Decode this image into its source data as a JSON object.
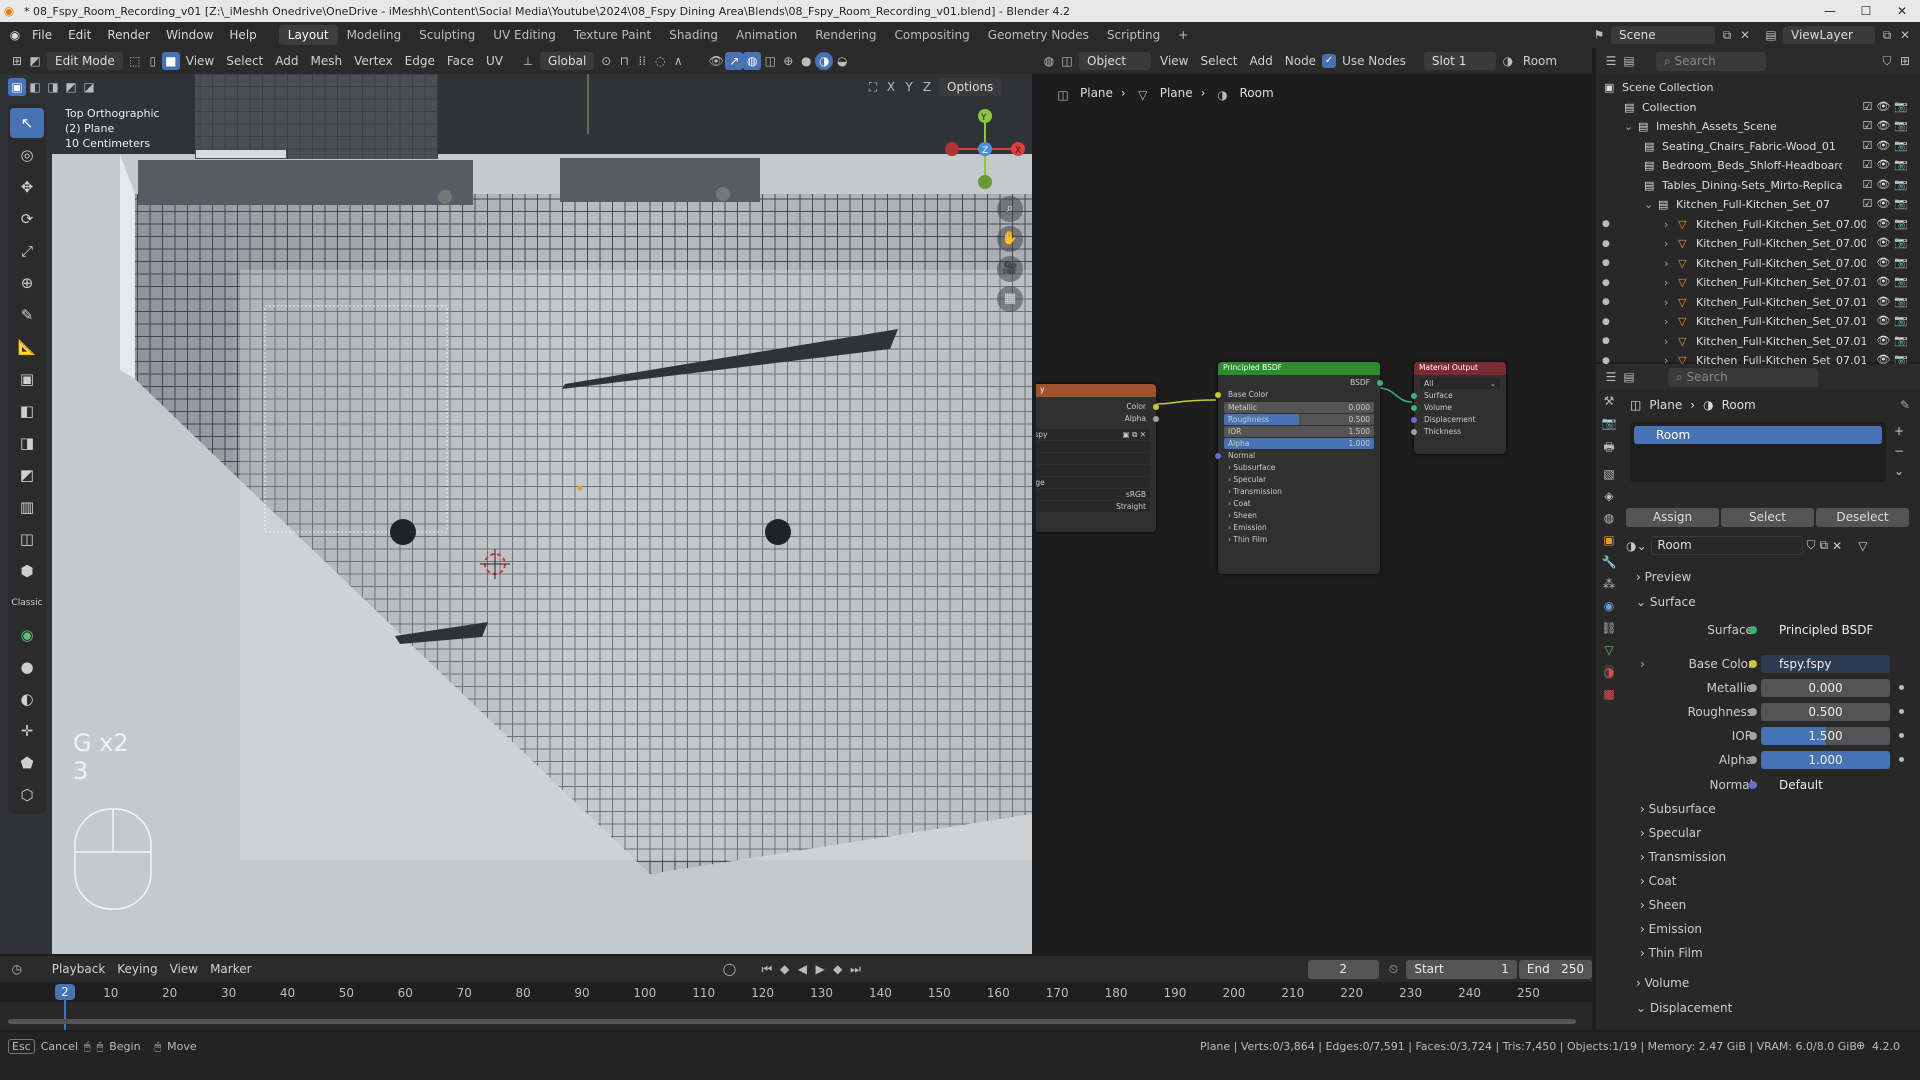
{
  "window": {
    "title": "* 08_Fspy_Room_Recording_v01 [Z:\\_iMeshh Onedrive\\OneDrive - iMeshh\\Content\\Social Media\\Youtube\\2024\\08_Fspy Dining Area\\Blends\\08_Fspy_Room_Recording_v01.blend] - Blender 4.2",
    "minimize": "—",
    "maximize": "☐",
    "close": "✕"
  },
  "menu": [
    "File",
    "Edit",
    "Render",
    "Window",
    "Help"
  ],
  "workspaces": [
    "Layout",
    "Modeling",
    "Sculpting",
    "UV Editing",
    "Texture Paint",
    "Shading",
    "Animation",
    "Rendering",
    "Compositing",
    "Geometry Nodes",
    "Scripting"
  ],
  "workspace_add": "+",
  "scene": {
    "label": "Scene",
    "viewlayer": "ViewLayer"
  },
  "viewport": {
    "mode": "Edit Mode",
    "menus": [
      "View",
      "Select",
      "Add",
      "Mesh",
      "Vertex",
      "Edge",
      "Face",
      "UV"
    ],
    "orientation": "Global",
    "options": "Options",
    "axes": [
      "X",
      "Y",
      "Z"
    ],
    "overlay_lines": [
      "Top Orthographic",
      "(2) Plane",
      "10 Centimeters"
    ],
    "keys_text": "G x2",
    "keys_sub": "3",
    "gizmo": {
      "y": "Y",
      "z": "Z",
      "x": "X"
    }
  },
  "tools": [
    "↖",
    "◎",
    "✥",
    "⟳",
    "⤢",
    "⊕",
    "✎",
    "📐",
    "▣",
    "◧",
    "◨",
    "◩",
    "▥",
    "◫",
    "⬢",
    "Classic",
    "◉",
    "●",
    "◐",
    "✛",
    "⬟",
    "⬡"
  ],
  "node_editor": {
    "object_dd": "Object",
    "menus": [
      "View",
      "Select",
      "Add",
      "Node"
    ],
    "use_nodes": "Use Nodes",
    "slot": "Slot 1",
    "material": "Room",
    "breadcrumb": [
      "Plane",
      "Plane",
      "Room"
    ],
    "tex_node": {
      "title": "y",
      "outputs": [
        "Color",
        "Alpha"
      ],
      "file": "y.fspy",
      "fields": [
        "",
        "",
        "",
        "nage",
        "sRGB",
        "Straight"
      ],
      "field_labels": [
        "",
        "",
        "",
        "",
        "ce",
        ""
      ]
    },
    "bsdf_node": {
      "title": "Principled BSDF",
      "out": "BSDF",
      "rows": [
        "Base Color"
      ],
      "fields": [
        {
          "name": "Metallic",
          "value": "0.000"
        },
        {
          "name": "Roughness",
          "value": "0.500"
        },
        {
          "name": "IOR",
          "value": "1.500"
        },
        {
          "name": "Alpha",
          "value": "1.000"
        }
      ],
      "normal": "Normal",
      "panels": [
        "Subsurface",
        "Specular",
        "Transmission",
        "Coat",
        "Sheen",
        "Emission",
        "Thin Film"
      ]
    },
    "output_node": {
      "title": "Material Output",
      "target": "All",
      "inputs": [
        "Surface",
        "Volume",
        "Displacement",
        "Thickness"
      ]
    }
  },
  "outliner": {
    "search_placeholder": "Search",
    "items": [
      {
        "label": "Scene Collection",
        "indent": 0
      },
      {
        "label": "Collection",
        "indent": 1
      },
      {
        "label": "Imeshh_Assets_Scene",
        "indent": 1
      },
      {
        "label": "Seating_Chairs_Fabric-Wood_01",
        "indent": 2
      },
      {
        "label": "Bedroom_Beds_Shloff-Headboard-C",
        "indent": 2
      },
      {
        "label": "Tables_Dining-Sets_Mirto-Replica_C",
        "indent": 2
      },
      {
        "label": "Kitchen_Full-Kitchen_Set_07",
        "indent": 2
      },
      {
        "label": "Kitchen_Full-Kitchen_Set_07.00",
        "indent": 3
      },
      {
        "label": "Kitchen_Full-Kitchen_Set_07.00",
        "indent": 3
      },
      {
        "label": "Kitchen_Full-Kitchen_Set_07.00",
        "indent": 3
      },
      {
        "label": "Kitchen_Full-Kitchen_Set_07.01",
        "indent": 3
      },
      {
        "label": "Kitchen_Full-Kitchen_Set_07.01",
        "indent": 3
      },
      {
        "label": "Kitchen_Full-Kitchen_Set_07.01",
        "indent": 3
      },
      {
        "label": "Kitchen_Full-Kitchen_Set_07.01",
        "indent": 3
      },
      {
        "label": "Kitchen_Full-Kitchen_Set_07.01",
        "indent": 3
      }
    ]
  },
  "properties": {
    "search_placeholder": "Search",
    "breadcrumb": [
      "Plane",
      "Room"
    ],
    "slot_name": "Room",
    "buttons": [
      "Assign",
      "Select",
      "Deselect"
    ],
    "material_name": "Room",
    "preview": "Preview",
    "surface": "Surface",
    "rows": [
      {
        "label": "Surface",
        "value": "Principled BSDF",
        "color": "#3cb371"
      },
      {
        "label": "Base Color",
        "value": "fspy.fspy",
        "color": "#c9c93a"
      },
      {
        "label": "Metallic",
        "value": "0.000",
        "color": "#a0a0a0"
      },
      {
        "label": "Roughness",
        "value": "0.500",
        "color": "#a0a0a0"
      },
      {
        "label": "IOR",
        "value": "1.500",
        "color": "#a0a0a0"
      },
      {
        "label": "Alpha",
        "value": "1.000",
        "color": "#a0a0a0"
      },
      {
        "label": "Normal",
        "value": "Default",
        "color": "#6a6ad0"
      }
    ],
    "panels": [
      "Subsurface",
      "Specular",
      "Transmission",
      "Coat",
      "Sheen",
      "Emission",
      "Thin Film"
    ],
    "volume": "Volume",
    "displacement": "Displacement"
  },
  "timeline": {
    "menus": [
      "Playback",
      "Keying",
      "View",
      "Marker"
    ],
    "current": "2",
    "start_label": "Start",
    "start": "1",
    "end_label": "End",
    "end": "250",
    "ticks": [
      "10",
      "20",
      "30",
      "40",
      "50",
      "60",
      "70",
      "80",
      "90",
      "100",
      "110",
      "120",
      "130",
      "140",
      "150",
      "160",
      "170",
      "180",
      "190",
      "200",
      "210",
      "220",
      "230",
      "240",
      "250"
    ]
  },
  "status": {
    "left": [
      "Esc",
      "Cancel",
      "Begin",
      "Move"
    ],
    "right": "Plane | Verts:0/3,864 | Edges:0/7,591 | Faces:0/3,724 | Tris:7,450 | Objects:1/19 | Memory: 2.47 GiB | VRAM: 6.0/8.0 GiB",
    "version": "4.2.0"
  },
  "colors": {
    "accent": "#4772b3",
    "bsdf_header": "#2e8b2e",
    "output_header": "#7a2a32",
    "tex_header": "#a0522d"
  }
}
